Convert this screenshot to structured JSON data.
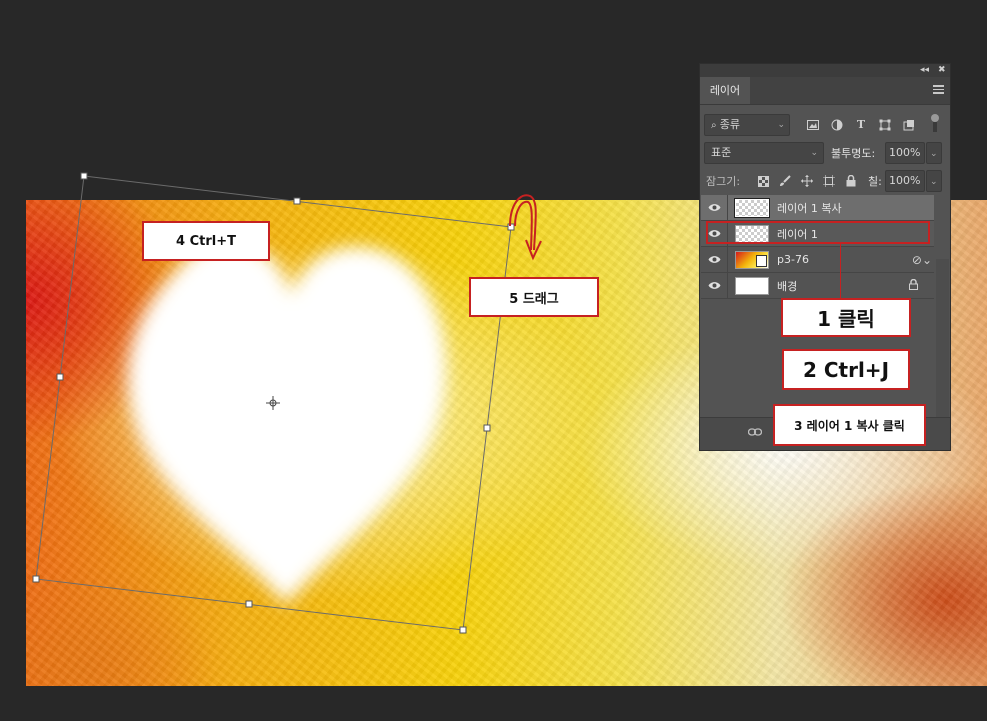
{
  "layers_panel": {
    "tab_label": "레이어",
    "filter": {
      "placeholder": "종류"
    },
    "blend_mode": "표준",
    "opacity_label": "불투명도:",
    "opacity_value": "100%",
    "lock_label": "잠그기:",
    "fill_label": "칠:",
    "fill_value": "100%",
    "layers": [
      {
        "name": "레이어 1 복사"
      },
      {
        "name": "레이어 1"
      },
      {
        "name": "p3-76"
      },
      {
        "name": "배경"
      }
    ]
  },
  "callouts": {
    "step1": "1 클릭",
    "step2": "2 Ctrl+J",
    "step3": "3 레이어 1 복사 클릭",
    "step4": "4 Ctrl+T",
    "step5": "5 드래그"
  },
  "colors": {
    "callout_border": "#c62121",
    "panel_bg": "#535353",
    "app_bg": "#282828"
  },
  "icons": [
    "eye-icon",
    "search-icon",
    "image-filter-icon",
    "adjust-filter-icon",
    "type-filter-icon",
    "shape-filter-icon",
    "smart-filter-icon",
    "lock-transparent-icon",
    "brush-icon",
    "move-icon",
    "artboard-icon",
    "lock-icon",
    "link-icon",
    "smart-object-icon",
    "curved-arrow-icon"
  ]
}
